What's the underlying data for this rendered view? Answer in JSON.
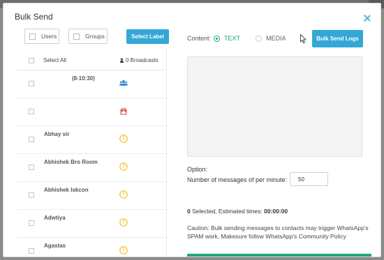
{
  "modal": {
    "title": "Bulk Send"
  },
  "filters": {
    "users_label": "Users",
    "groups_label": "Groups",
    "select_label_button": "Select Label"
  },
  "list": {
    "select_all": "Select All",
    "broadcasts": "0 Broadcasts",
    "rows": [
      {
        "name": "(8-10:30)",
        "icon": "group-icon"
      },
      {
        "name": "",
        "icon": "gift-icon"
      },
      {
        "name": "Abhay sir",
        "icon": "help-circle-icon"
      },
      {
        "name": "Abhishek Bro Room",
        "icon": "help-circle-icon"
      },
      {
        "name": "Abhishek Iskcon",
        "icon": "help-circle-icon"
      },
      {
        "name": "Adwtiya",
        "icon": "help-circle-icon"
      },
      {
        "name": "Agastas",
        "icon": "help-circle-icon"
      }
    ]
  },
  "content": {
    "label": "Content:",
    "text_option": "TEXT",
    "media_option": "MEDIA",
    "selected": "TEXT"
  },
  "bulk_send_logs_button": "Bulk Send Logs",
  "message_box": {
    "value": ""
  },
  "options": {
    "title": "Option:",
    "per_minute_label": "Number of messages of per minute:",
    "per_minute_value": "50"
  },
  "summary": {
    "selected_count": "0",
    "selected_text": " Selected, Estimated times: ",
    "estimated_time": "00:00:00"
  },
  "caution": "Caution: Bulk sending messages to contacts may trigger WhatsApp's SPAM work, Makesure follow WhatsApp's Community Policy",
  "colors": {
    "accent_blue": "#33a7d6",
    "accent_green": "#1aa87c",
    "help_icon": "#f0b400",
    "gift_icon": "#e0504a",
    "group_icon": "#2f8bd6"
  }
}
